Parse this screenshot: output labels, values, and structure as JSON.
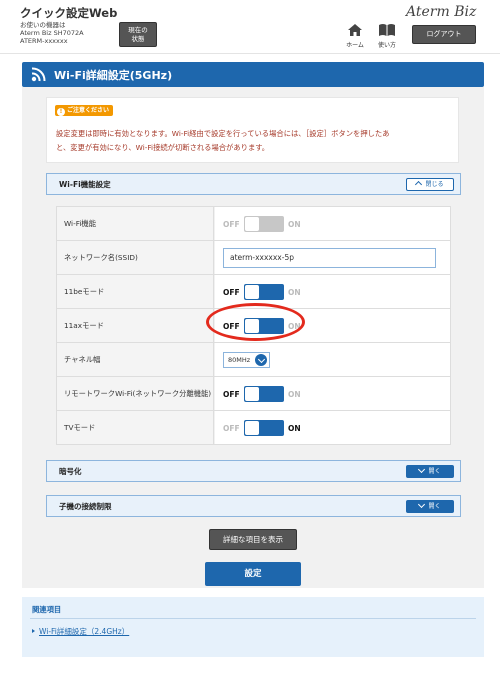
{
  "header": {
    "app_title": "クイック設定Web",
    "device_label": "お使いの機器は",
    "device_model": "Aterm Biz SH7072A",
    "device_id": "ATERM-xxxxxx",
    "status_button": [
      "現在の",
      "状態"
    ],
    "brand": "Aterm Biz",
    "home_label": "ホーム",
    "guide_label": "使い方",
    "logout_label": "ログアウト"
  },
  "page": {
    "title": "Wi-Fi詳細設定(5GHz)"
  },
  "notice": {
    "badge": "ご注意ください",
    "lines": [
      "設定変更は即時に有効となります。Wi-Fi経由で設定を行っている場合には、［設定］ボタンを押したあ",
      "と、変更が有効になり、Wi-Fi接続が切断される場合があります。"
    ]
  },
  "wifi_section": {
    "title": "Wi-Fi機能設定",
    "toggle_label": "閉じる",
    "rows": [
      {
        "label": "Wi-Fi機能",
        "type": "toggle",
        "state": "off",
        "off": "OFF",
        "on": "ON"
      },
      {
        "label": "ネットワーク名(SSID)",
        "type": "text",
        "value": "aterm-xxxxxx-5p"
      },
      {
        "label": "11beモード",
        "type": "toggle",
        "state": "on",
        "off": "OFF",
        "on": "ON"
      },
      {
        "label": "11axモード",
        "type": "toggle",
        "state": "off",
        "off": "OFF",
        "on": "ON"
      },
      {
        "label": "チャネル幅",
        "type": "select",
        "value": "80MHz"
      },
      {
        "label": "リモートワークWi-Fi(ネットワーク分離機能)",
        "type": "toggle",
        "state": "off",
        "off": "OFF",
        "on": "ON"
      },
      {
        "label": "TVモード",
        "type": "toggle",
        "state": "on",
        "off": "OFF",
        "on": "ON"
      }
    ]
  },
  "encryption_section": {
    "title": "暗号化",
    "toggle_label": "開く"
  },
  "client_limit_section": {
    "title": "子機の接続制限",
    "toggle_label": "開く"
  },
  "buttons": {
    "show_details": "詳細な項目を表示",
    "apply": "設定"
  },
  "related": {
    "title": "関連項目",
    "link": "Wi-Fi詳細設定（2.4GHz）"
  },
  "colors": {
    "accent": "#1e67ad",
    "notice_text": "#a63a2a",
    "highlight": "#e32a1d"
  }
}
